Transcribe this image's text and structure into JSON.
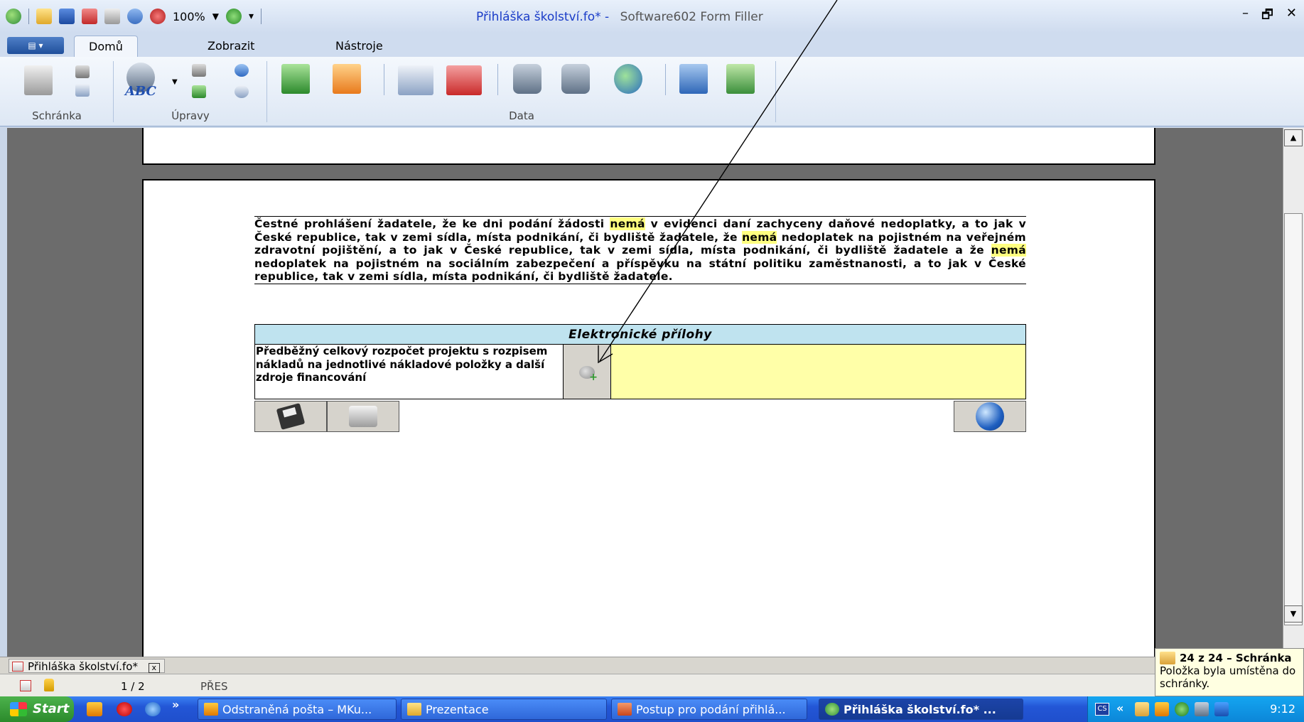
{
  "window": {
    "title_doc": "Přihláška školství.fo* -",
    "title_app": "Software602 Form Filler",
    "zoom": "100%",
    "controls": [
      "–",
      "🗗",
      "✕"
    ]
  },
  "ribbon": {
    "app_button": "▤ ▾",
    "tabs": [
      "Domů",
      "Zobrazit",
      "Nástroje"
    ],
    "active_tab": "Domů",
    "groups": [
      "Schránka",
      "Úpravy",
      "Data"
    ],
    "abc_label": "ABC"
  },
  "document": {
    "declaration": {
      "p1": "Čestné prohlášení žadatele, že ke dni podání žádosti ",
      "m1": "nemá",
      "p2": " v evidenci daní zachyceny daňové nedoplatky, a to jak v České republice, tak v zemi sídla, místa podnikání, či bydliště žadatele, že ",
      "m2": "nemá",
      "p3": " nedoplatek na pojistném na veřejném zdravotní pojištění, a to jak v České republice, tak v zemi sídla, místa podnikání, či bydliště žadatele a že ",
      "m3": "nemá",
      "p4": " nedoplatek na pojistném na sociálním zabezpečení a příspěvku na státní politiku zaměstnanosti, a to jak v České republice, tak v zemi sídla, místa podnikání, či bydliště žadatele."
    },
    "attachments": {
      "header": "Elektronické přílohy",
      "item_label": "Předběžný celkový rozpočet projektu s rozpisem nákladů na jednotlivé nákladové položky a další zdroje financování"
    }
  },
  "doc_tab": {
    "name": "Přihláška školství.fo*",
    "close": "x"
  },
  "status": {
    "pages": "1 / 2",
    "mode": "PŘES"
  },
  "balloon": {
    "title": "24 z 24 – Schránka",
    "message": "Položka byla umístěna do schránky."
  },
  "taskbar": {
    "start": "Start",
    "chevron": "»",
    "items": [
      "Odstraněná pošta – MKu...",
      "Prezentace",
      "Postup pro podání přihlá...",
      "Přihláška školství.fo* ..."
    ],
    "tray_lang": "CS",
    "tray_expand": "«",
    "clock": "9:12"
  }
}
